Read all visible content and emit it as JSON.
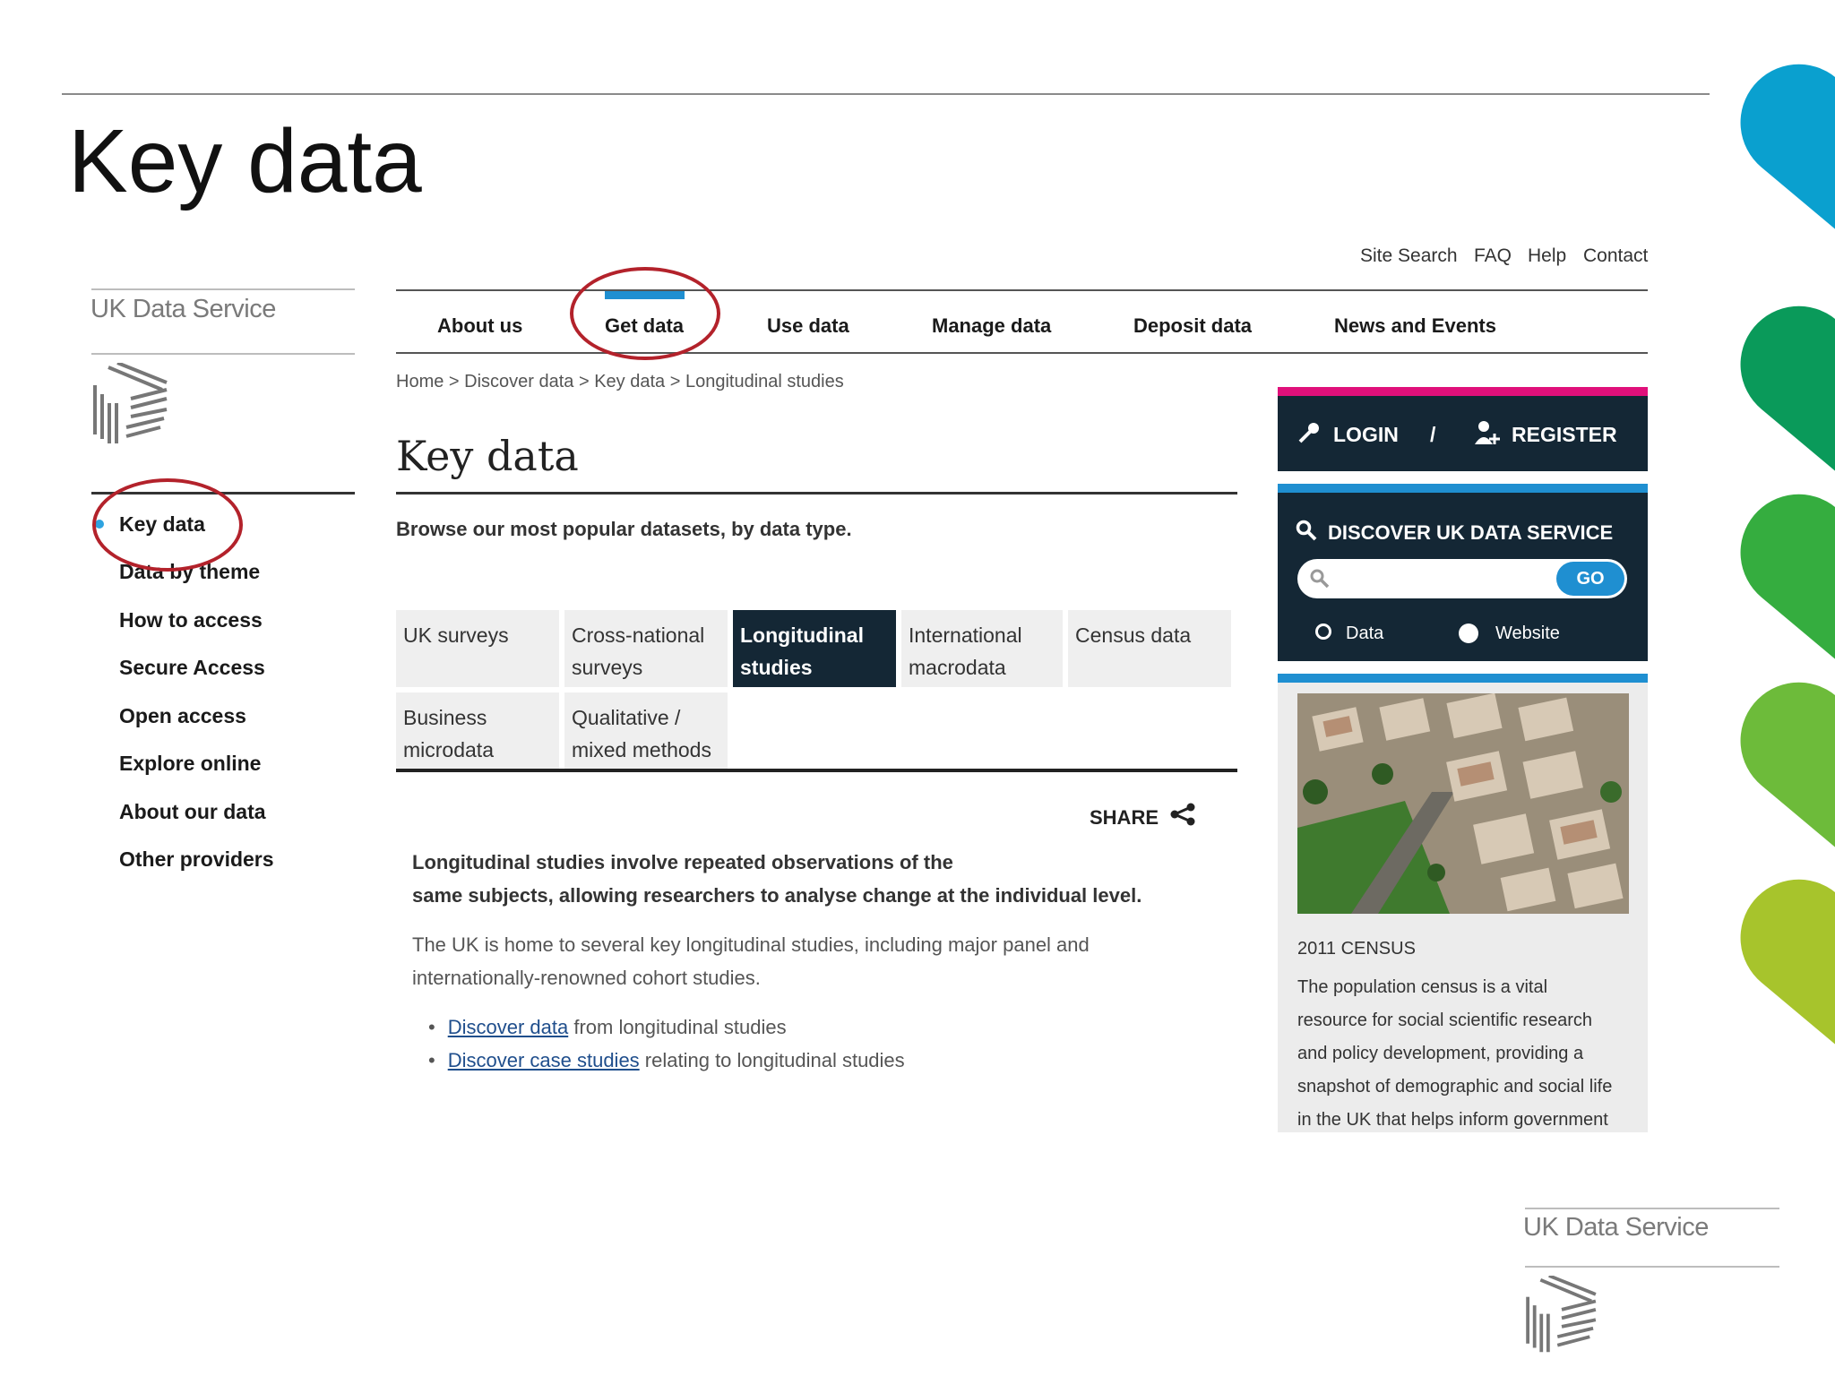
{
  "slide": {
    "title": "Key data"
  },
  "brand": {
    "name": "UK Data Service"
  },
  "top_links": [
    "Site Search",
    "FAQ",
    "Help",
    "Contact"
  ],
  "nav": [
    "About us",
    "Get data",
    "Use data",
    "Manage data",
    "Deposit data",
    "News and Events"
  ],
  "breadcrumb": "Home > Discover data > Key data > Longitudinal studies",
  "page": {
    "heading": "Key data",
    "intro": "Browse our most popular datasets, by data type."
  },
  "sidebar": [
    {
      "label": "Key data",
      "active": true
    },
    {
      "label": "Data by theme"
    },
    {
      "label": "How to access"
    },
    {
      "label": "Secure Access"
    },
    {
      "label": "Open access"
    },
    {
      "label": "Explore online"
    },
    {
      "label": "About our data"
    },
    {
      "label": "Other providers"
    }
  ],
  "tabs": [
    {
      "line1": "UK surveys",
      "line2": ""
    },
    {
      "line1": "Cross-national",
      "line2": "surveys"
    },
    {
      "line1": "Longitudinal",
      "line2": "studies"
    },
    {
      "line1": "International",
      "line2": "macrodata"
    },
    {
      "line1": "Census data",
      "line2": ""
    },
    {
      "line1": "Business",
      "line2": "microdata"
    },
    {
      "line1": "Qualitative /",
      "line2": "mixed methods"
    }
  ],
  "share_label": "SHARE",
  "content": {
    "lead_line1": "Longitudinal studies involve repeated observations of the",
    "lead_line2": "same subjects, allowing researchers to analyse change at the individual level.",
    "para_line1": "The UK is home to several key longitudinal studies, including major panel and",
    "para_line2": "internationally-renowned cohort studies.",
    "bullet1_link": "Discover data",
    "bullet1_text": " from longitudinal studies",
    "bullet2_link": "Discover case studies",
    "bullet2_text": " relating to longitudinal studies"
  },
  "auth": {
    "login": "LOGIN",
    "separator": "/",
    "register": "REGISTER"
  },
  "discover": {
    "title": "DISCOVER UK DATA SERVICE",
    "search_placeholder": "",
    "go": "GO",
    "radio_data": "Data",
    "radio_website": "Website"
  },
  "census": {
    "title": "2011 CENSUS",
    "lines": [
      "The population census is a vital",
      "resource for social scientific research",
      "and policy development, providing a",
      "snapshot of demographic and social life",
      "in the UK that helps inform government"
    ]
  },
  "colors": {
    "accent_blue": "#1f8fd1",
    "navy": "#142735",
    "pink": "#e0107a",
    "annotation_red": "#b3222b"
  }
}
